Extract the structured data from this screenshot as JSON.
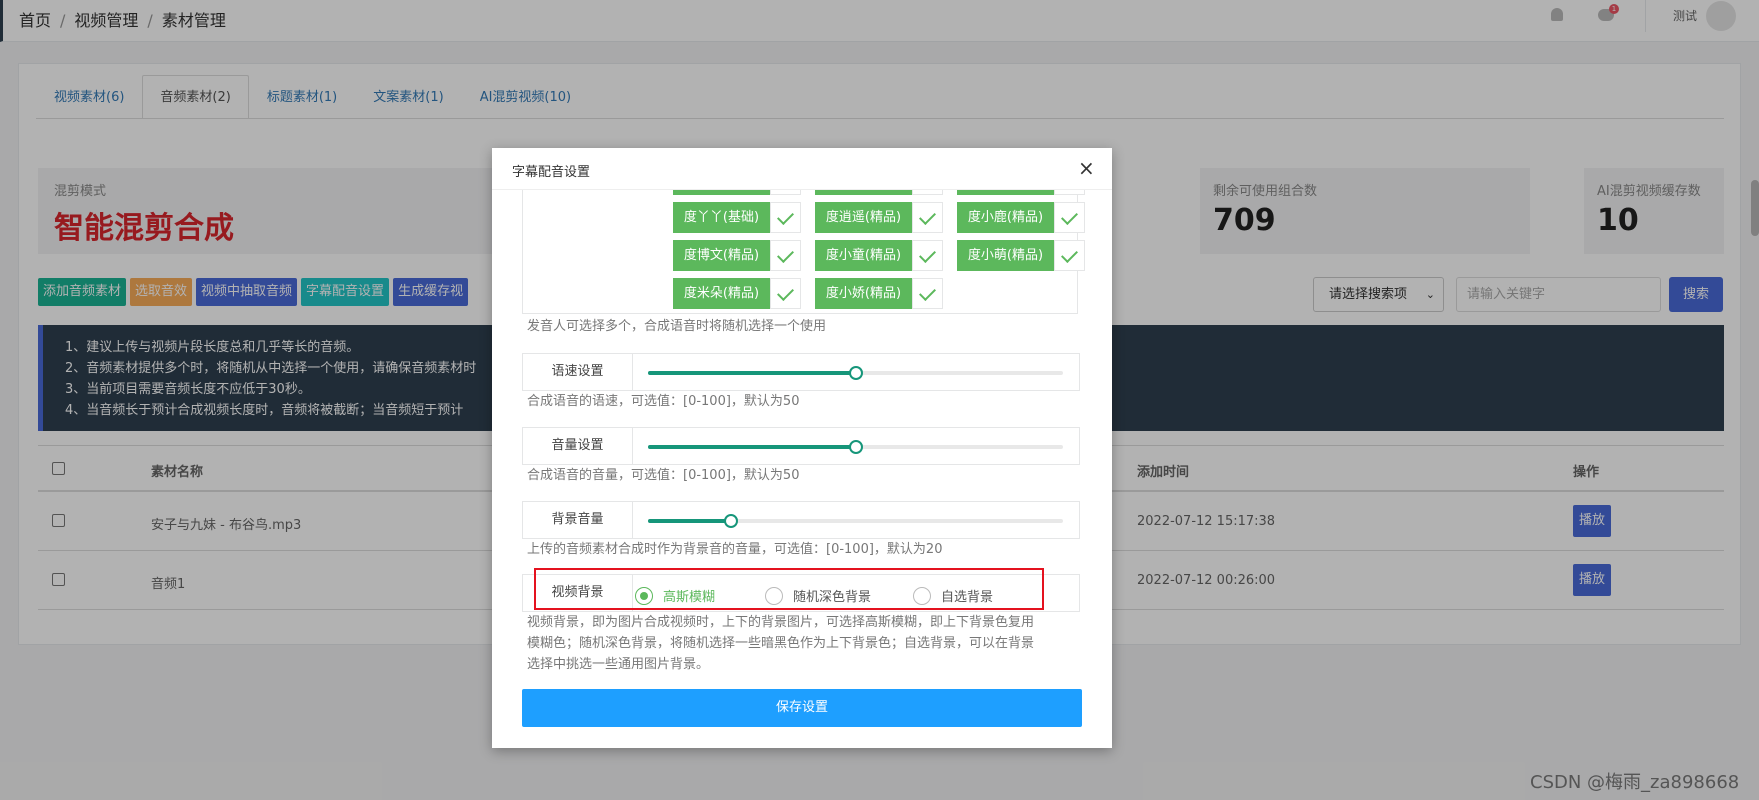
{
  "breadcrumb": [
    "首页",
    "视频管理",
    "素材管理"
  ],
  "header": {
    "notification_count": "1",
    "username": "测试"
  },
  "tabs": [
    {
      "label": "视频素材(6)",
      "active": false
    },
    {
      "label": "音频素材(2)",
      "active": true
    },
    {
      "label": "标题素材(1)",
      "active": false
    },
    {
      "label": "文案素材(1)",
      "active": false
    },
    {
      "label": "AI混剪视频(10)",
      "active": false
    }
  ],
  "stats": {
    "mode_label": "混剪模式",
    "mode_value": "智能混剪合成",
    "remaining_label": "剩余可使用组合数",
    "remaining_value": "709",
    "cache_label": "AI混剪视频缓存数",
    "cache_value": "10"
  },
  "toolbar": {
    "add_audio": "添加音频素材",
    "pick_effect": "选取音效",
    "extract_audio": "视频中抽取音频",
    "subtitle_voice": "字幕配音设置",
    "gen_cache": "生成缓存视",
    "search_select": "请选择搜索项",
    "keyword_placeholder": "请输入关键字",
    "search_btn": "搜索"
  },
  "notice": [
    "1、建议上传与视频片段长度总和几乎等长的音频。",
    "2、音频素材提供多个时，将随机从中选择一个使用，请确保音频素材时",
    "3、当前项目需要音频长度不应低于30秒。",
    "4、当音频长于预计合成视频长度时，音频将被截断；当音频短于预计"
  ],
  "table": {
    "headers": {
      "name": "素材名称",
      "time": "添加时间",
      "action": "操作"
    },
    "rows": [
      {
        "name": "安子与九妹 - 布谷鸟.mp3",
        "time": "2022-07-12 15:17:38",
        "action": "播放"
      },
      {
        "name": "音频1",
        "time": "2022-07-12 00:26:00",
        "action": "播放"
      }
    ]
  },
  "modal": {
    "title": "字幕配音设置",
    "close": "×",
    "speakers": [
      "度丫丫(基础)",
      "度逍遥(精品)",
      "度小鹿(精品)",
      "度博文(精品)",
      "度小童(精品)",
      "度小萌(精品)",
      "度米朵(精品)",
      "度小娇(精品)"
    ],
    "speakers_help": "发音人可选择多个，合成语音时将随机选择一个使用",
    "speed_label": "语速设置",
    "speed_value": 50,
    "speed_help": "合成语音的语速，可选值：[0-100]，默认为50",
    "volume_label": "音量设置",
    "volume_value": 50,
    "volume_help": "合成语音的音量，可选值：[0-100]，默认为50",
    "bg_volume_label": "背景音量",
    "bg_volume_value": 20,
    "bg_volume_help": "上传的音频素材合成时作为背景音的音量，可选值：[0-100]，默认为20",
    "bg_label": "视频背景",
    "bg_options": [
      "高斯模糊",
      "随机深色背景",
      "自选背景"
    ],
    "bg_selected": "高斯模糊",
    "bg_help": [
      "视频背景，即为图片合成视频时，上下的背景图片，可选择高斯模糊，即上下背景色复用",
      "模糊色；随机深色背景，将随机选择一些暗黑色作为上下背景色；自选背景，可以在背景",
      "选择中挑选一些通用图片背景。"
    ],
    "save": "保存设置"
  },
  "watermark": "CSDN @梅雨_za898668",
  "colors": {
    "accent": "#4a6bd9",
    "slider": "#16967a",
    "speaker": "#5cb85c",
    "save": "#1e9fff",
    "highlight": "#e4121f",
    "mode_red": "#d9262d"
  }
}
